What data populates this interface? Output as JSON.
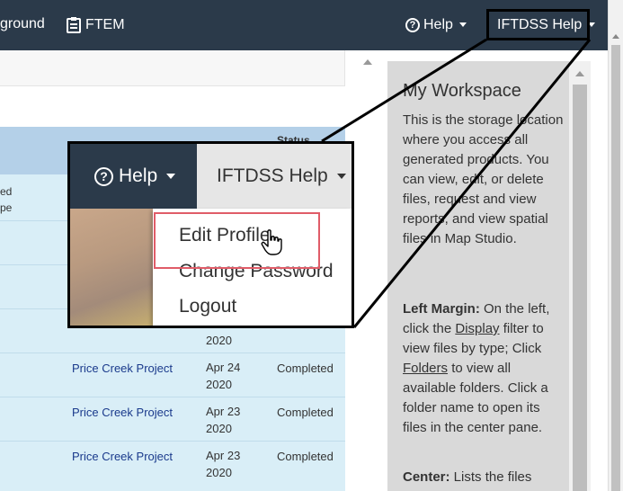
{
  "nav": {
    "left_partial": "ground",
    "ftem_label": "FTEM",
    "help_label": "Help",
    "iftdss_help_label": "IFTDSS Help"
  },
  "table": {
    "status_header": "Status",
    "left_fragments": [
      "ed",
      "pe"
    ],
    "rows": [
      {
        "project": "Price Creek Project",
        "date_line1": "Apr 24",
        "date_line2": "2020",
        "status": "Completed"
      },
      {
        "project": "Price Creek Project",
        "date_line1": "Apr 23",
        "date_line2": "2020",
        "status": "Completed"
      },
      {
        "project": "Price Creek Project",
        "date_line1": "Apr 23",
        "date_line2": "2020",
        "status": "Completed"
      }
    ],
    "partial_year": "2020"
  },
  "workspace": {
    "title": "My Workspace",
    "intro": "This is the storage location where you access all generated products. You can view, edit, or delete files, request and view reports, and view spatial files in Map Studio.",
    "left_margin_label": "Left Margin:",
    "left_margin_text_1": " On the left, click the ",
    "display_link": "Display",
    "left_margin_text_2": " filter to view files by type; Click ",
    "folders_link": "Folders",
    "left_margin_text_3": " to view all available folders. Click a folder name to open its files in the center pane.",
    "center_label": "Center:",
    "center_text": " Lists the files"
  },
  "callout": {
    "help_label": "Help",
    "iftdss_help_label": "IFTDSS Help",
    "menu_items": [
      "Edit Profile",
      "Change Password",
      "Logout"
    ]
  },
  "colors": {
    "navbar": "#2b3a4a",
    "table_bg": "#d9eef7",
    "table_header": "#b4d0e8",
    "highlight": "#e05c68",
    "link": "#1a3a8c"
  }
}
